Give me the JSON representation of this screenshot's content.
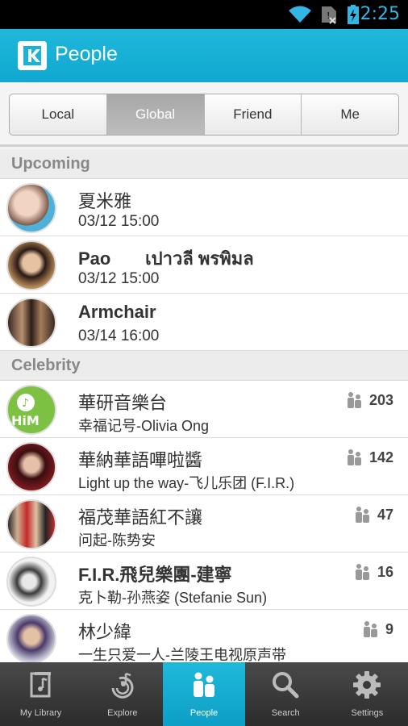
{
  "status_bar": {
    "time": "2:25"
  },
  "action_bar": {
    "title": "People",
    "logo_icon": "k-logo-icon"
  },
  "tabs": [
    {
      "label": "Local",
      "active": false
    },
    {
      "label": "Global",
      "active": true
    },
    {
      "label": "Friend",
      "active": false
    },
    {
      "label": "Me",
      "active": false
    }
  ],
  "sections": {
    "upcoming": {
      "title": "Upcoming",
      "items": [
        {
          "name": "夏米雅",
          "date": "03/12 15:00"
        },
        {
          "name": "Pao       เปาวลี พรพิมล",
          "date": "03/12 15:00"
        },
        {
          "name": "Armchair",
          "date": "03/14 16:00"
        }
      ]
    },
    "celebrity": {
      "title": "Celebrity",
      "items": [
        {
          "name": "華研音樂台",
          "song": "幸福记号-Olivia Ong",
          "count": "203"
        },
        {
          "name": "華納華語嗶啦醬",
          "song": "Light up the way-飞儿乐团 (F.I.R.)",
          "count": "142"
        },
        {
          "name": "福茂華語紅不讓",
          "song": "问起-陈势安",
          "count": "47"
        },
        {
          "name": "F.I.R.飛兒樂團-建寧",
          "song": "克卜勒-孙燕姿 (Stefanie Sun)",
          "count": "16"
        },
        {
          "name": "林少緯",
          "song": "一生只爱一人-兰陵王电视原声带",
          "count": "9"
        }
      ]
    }
  },
  "bottom_nav": [
    {
      "label": "My Library",
      "icon": "library-icon",
      "active": false
    },
    {
      "label": "Explore",
      "icon": "explore-icon",
      "active": false
    },
    {
      "label": "People",
      "icon": "people-icon",
      "active": true
    },
    {
      "label": "Search",
      "icon": "search-icon",
      "active": false
    },
    {
      "label": "Settings",
      "icon": "gear-icon",
      "active": false
    }
  ],
  "colors": {
    "accent": "#1fb8db",
    "status_time": "#33b5e5"
  }
}
